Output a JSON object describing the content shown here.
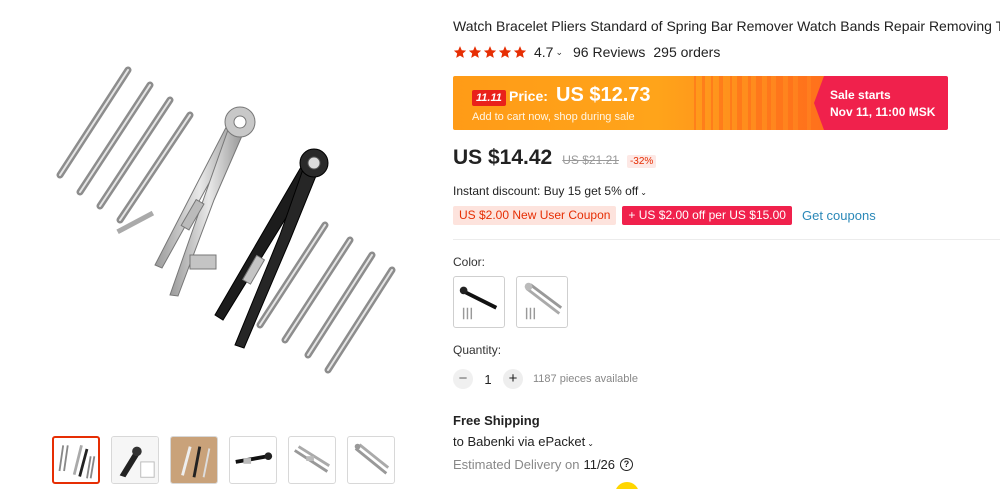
{
  "product": {
    "title": "Watch Bracelet Pliers Standard of Spring Bar Remover Watch Bands Repair Removing Tool",
    "rating": "4.7",
    "rating_caret": "⌄",
    "reviews": "96 Reviews",
    "orders": "295 orders"
  },
  "sale_banner": {
    "badge": "11.11",
    "price_label": "Price:",
    "price": "US $12.73",
    "subtitle": "Add to cart now, shop during sale",
    "starts_line1": "Sale starts",
    "starts_line2": "Nov 11, 11:00 MSK"
  },
  "pricing": {
    "current": "US $14.42",
    "original": "US $21.21",
    "discount": "-32%"
  },
  "instant_discount": "Instant discount: Buy 15 get 5% off",
  "coupons": {
    "new_user": "US $2.00 New User Coupon",
    "store": "+ US $2.00 off per US $15.00",
    "get_link": "Get coupons"
  },
  "color": {
    "label": "Color:",
    "options": [
      "black-pliers",
      "silver-pliers"
    ]
  },
  "quantity": {
    "label": "Quantity:",
    "minus": "−",
    "value": "1",
    "plus": "+",
    "available": "1187 pieces available"
  },
  "shipping": {
    "title": "Free Shipping",
    "to": "to Babenki via ePacket",
    "delivery_label": "Estimated Delivery on",
    "delivery_date": "11/26",
    "help": "?"
  },
  "gallery": {
    "thumbnails": [
      "thumb-1",
      "thumb-2",
      "thumb-3",
      "thumb-4",
      "thumb-5",
      "thumb-6"
    ]
  },
  "colors": {
    "star": "#e62e04",
    "banner_orange": "#ffa41a",
    "banner_red": "#f0214c",
    "link": "#2a88b8"
  }
}
